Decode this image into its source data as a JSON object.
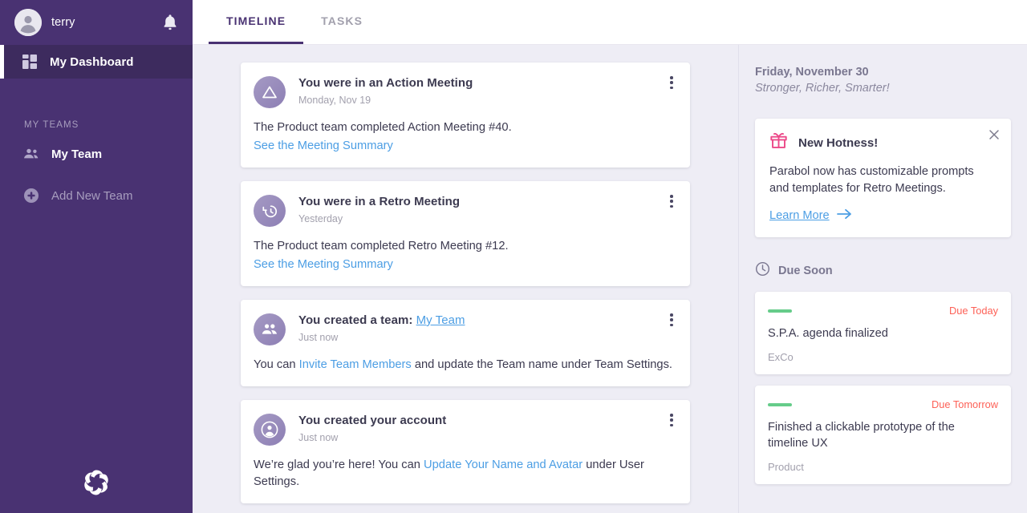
{
  "sidebar": {
    "user": {
      "name": "terry",
      "avatar_icon": "person-avatar-icon"
    },
    "notifications_icon": "bell-icon",
    "active_item": {
      "label": "My Dashboard",
      "icon": "dashboard-grid-icon"
    },
    "section_title": "MY TEAMS",
    "items": [
      {
        "label": "My Team",
        "icon": "team-people-icon"
      },
      {
        "label": "Add New Team",
        "icon": "plus-circle-icon"
      }
    ],
    "logo_name": "parabol-logo",
    "colors": {
      "bg": "#493272",
      "active_bg": "#3d2b5e",
      "muted_text": "#a79dbe"
    }
  },
  "tabs": [
    {
      "label": "TIMELINE",
      "active": true
    },
    {
      "label": "TASKS",
      "active": false
    }
  ],
  "timeline": {
    "cards": [
      {
        "icon": "action-meeting-triangle-icon",
        "title": "You were in an Action Meeting",
        "title_link": "",
        "time": "Monday, Nov 19",
        "body": "The Product team completed Action Meeting #40.",
        "link": "See the Meeting Summary",
        "menu_icon": "kebab-menu-icon"
      },
      {
        "icon": "retro-meeting-history-icon",
        "title": "You were in a Retro Meeting",
        "title_link": "",
        "time": "Yesterday",
        "body": "The Product team completed Retro Meeting #12.",
        "link": "See the Meeting Summary",
        "menu_icon": "kebab-menu-icon"
      },
      {
        "icon": "team-created-people-icon",
        "title": "You created a team:",
        "title_link": "My Team",
        "time": "Just now",
        "body_before": "You can ",
        "body_link": "Invite Team Members",
        "body_after": " and update the Team name under Team Settings.",
        "menu_icon": "kebab-menu-icon"
      },
      {
        "icon": "account-created-person-icon",
        "title": "You created your account",
        "title_link": "",
        "time": "Just now",
        "body_before": "We’re glad you’re here! You can ",
        "body_link": "Update Your Name and Avatar",
        "body_after": " under User Settings.",
        "menu_icon": "kebab-menu-icon"
      }
    ]
  },
  "rail": {
    "date": "Friday, November 30",
    "tagline": "Stronger, Richer, Smarter!",
    "promo": {
      "icon": "gift-icon",
      "icon_color": "#ec4989",
      "title": "New Hotness!",
      "text": "Parabol now has customizable prompts and templates for Retro Meetings.",
      "cta": "Learn More",
      "cta_icon": "arrow-right-icon",
      "close_icon": "close-x-icon"
    },
    "due_soon": {
      "icon": "clock-icon",
      "label": "Due Soon",
      "tasks": [
        {
          "status_color": "#66cc8a",
          "due": "Due Today",
          "title": "S.P.A. agenda finalized",
          "team": "ExCo"
        },
        {
          "status_color": "#66cc8a",
          "due": "Due Tomorrow",
          "title": "Finished a clickable prototype of the timeline UX",
          "team": "Product"
        }
      ]
    }
  }
}
